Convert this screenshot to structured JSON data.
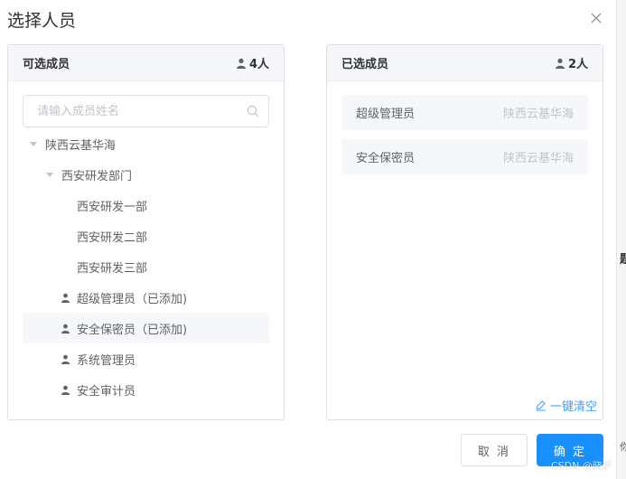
{
  "dialog": {
    "title": "选择人员"
  },
  "left_panel": {
    "title": "可选成员",
    "count": "4人",
    "search_placeholder": "请输入成员姓名",
    "tree": [
      {
        "label": "陕西云基华海"
      },
      {
        "label": "西安研发部门"
      },
      {
        "label": "西安研发一部"
      },
      {
        "label": "西安研发二部"
      },
      {
        "label": "西安研发三部"
      },
      {
        "label": "超级管理员（已添加)"
      },
      {
        "label": "安全保密员（已添加)"
      },
      {
        "label": "系统管理员"
      },
      {
        "label": "安全审计员"
      }
    ]
  },
  "right_panel": {
    "title": "已选成员",
    "count": "2人",
    "items": [
      {
        "name": "超级管理员",
        "org": "陕西云基华海"
      },
      {
        "name": "安全保密员",
        "org": "陕西云基华海"
      }
    ],
    "clear_all": "一键清空"
  },
  "footer": {
    "cancel": "取 消",
    "ok": "确 定"
  },
  "background_edge": {
    "char_1": "题",
    "char_2": "你"
  },
  "watermark": "CSDN @晓萨",
  "colors": {
    "primary": "#1890ff",
    "link": "#409eff",
    "header_bg": "#f5f7fa",
    "border": "#dcdfe6"
  }
}
